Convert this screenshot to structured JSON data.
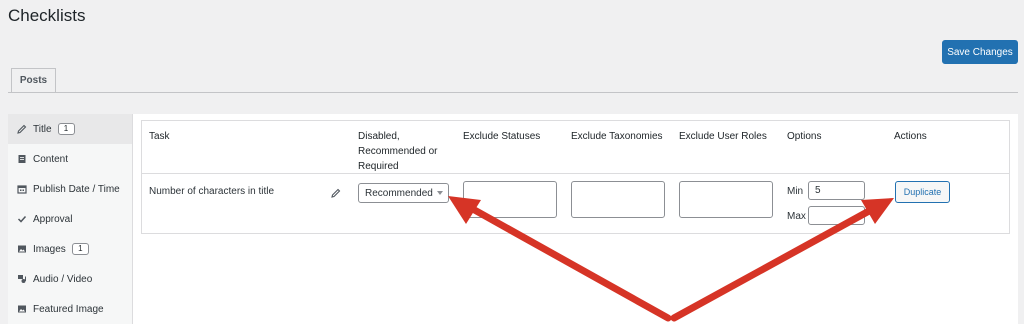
{
  "page": {
    "title": "Checklists",
    "save_label": "Save Changes"
  },
  "tabs": [
    {
      "label": "Posts",
      "active": true
    }
  ],
  "sidebar": {
    "items": [
      {
        "label": "Title",
        "icon": "pencil-icon",
        "badge": "1",
        "active": true
      },
      {
        "label": "Content",
        "icon": "document-icon",
        "badge": ""
      },
      {
        "label": "Publish Date / Time",
        "icon": "calendar-icon",
        "badge": ""
      },
      {
        "label": "Approval",
        "icon": "checkmark-icon",
        "badge": ""
      },
      {
        "label": "Images",
        "icon": "image-icon",
        "badge": "1"
      },
      {
        "label": "Audio / Video",
        "icon": "media-icon",
        "badge": ""
      },
      {
        "label": "Featured Image",
        "icon": "image-icon",
        "badge": ""
      }
    ]
  },
  "table": {
    "headers": {
      "task": "Task",
      "requirement_line1": "Disabled,",
      "requirement_line2": "Recommended or",
      "requirement_line3": "Required",
      "statuses": "Exclude Statuses",
      "taxonomies": "Exclude Taxonomies",
      "roles": "Exclude User Roles",
      "options": "Options",
      "actions": "Actions"
    },
    "row": {
      "task": "Number of characters in title",
      "requirement": "Recommended",
      "min_label": "Min",
      "min_value": "5",
      "max_label": "Max",
      "max_value": "",
      "duplicate_label": "Duplicate"
    }
  },
  "colors": {
    "accent": "#2271b1",
    "annotation_arrow": "#d63426"
  }
}
